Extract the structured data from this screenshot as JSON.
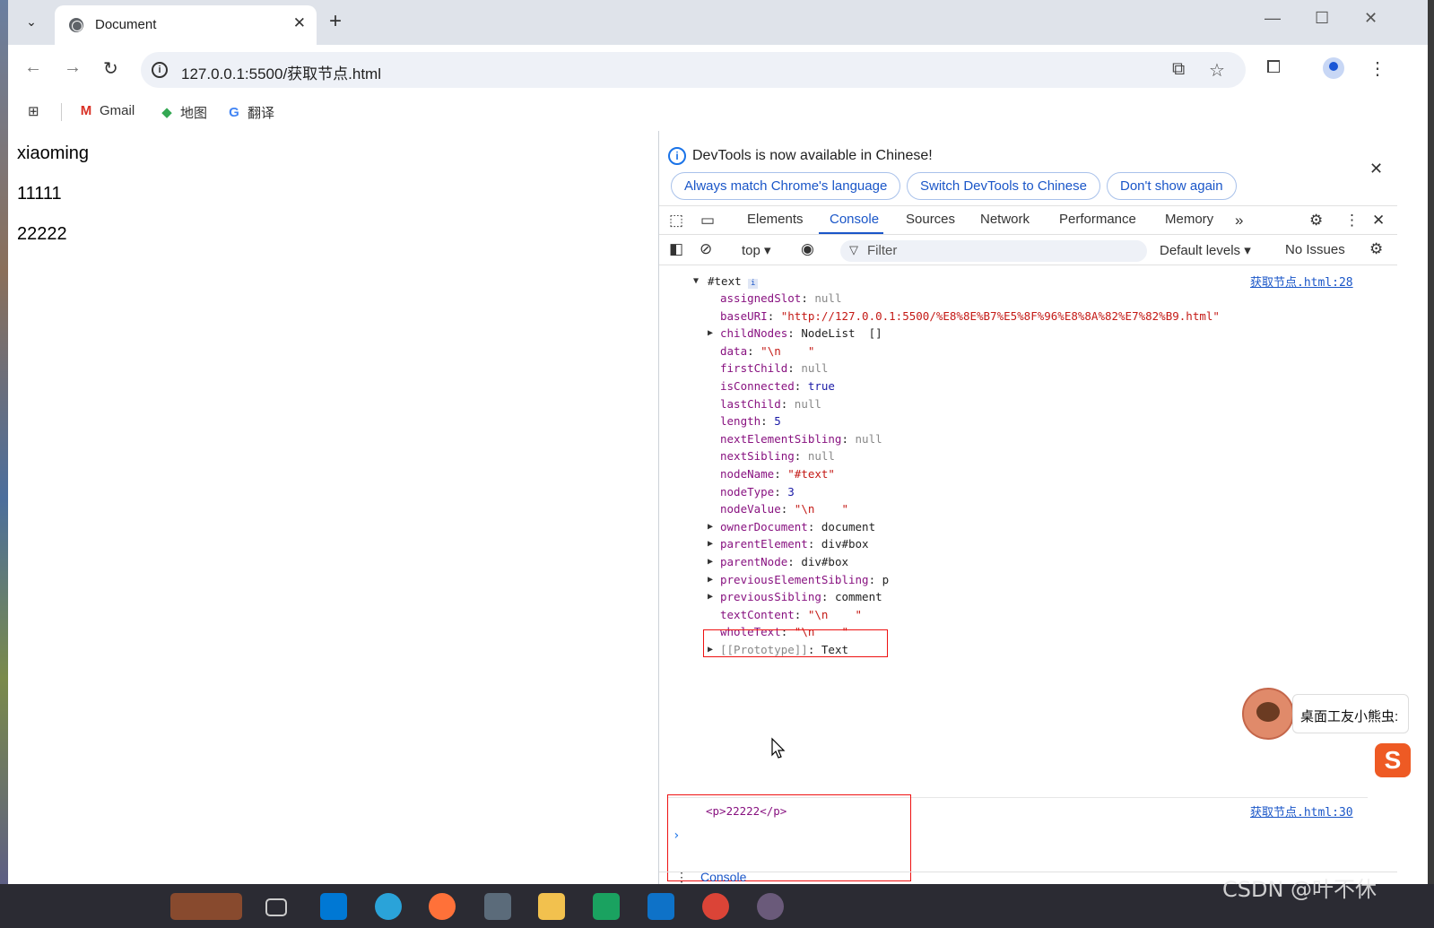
{
  "browser": {
    "tab_title": "Document",
    "url": "127.0.0.1:5500/获取节点.html",
    "bookmarks": [
      {
        "label": "Gmail",
        "icon": "gmail-icon"
      },
      {
        "label": "地图",
        "icon": "maps-icon"
      },
      {
        "label": "翻译",
        "icon": "translate-icon"
      }
    ]
  },
  "page": {
    "lines": [
      "xiaoming",
      "11111",
      "22222"
    ]
  },
  "devtools": {
    "infobar": {
      "message": "DevTools is now available in Chinese!",
      "buttons": [
        "Always match Chrome's language",
        "Switch DevTools to Chinese",
        "Don't show again"
      ]
    },
    "tabs": [
      "Elements",
      "Console",
      "Sources",
      "Network",
      "Performance",
      "Memory"
    ],
    "active_tab": "Console",
    "filterbar": {
      "context": "top",
      "filter_placeholder": "Filter",
      "levels": "Default levels",
      "issues": "No Issues"
    },
    "console": {
      "entry1": {
        "header": "#text",
        "source": "获取节点.html:28",
        "props": [
          {
            "key": "assignedSlot",
            "value": "null",
            "type": "nul",
            "expandable": false
          },
          {
            "key": "baseURI",
            "value": "\"http://127.0.0.1:5500/%E8%8E%B7%E5%8F%96%E8%8A%82%E7%82%B9.html\"",
            "type": "str",
            "expandable": false
          },
          {
            "key": "childNodes",
            "value": "NodeList  []",
            "type": "obj",
            "expandable": true
          },
          {
            "key": "data",
            "value": "\"\\n    \"",
            "type": "str",
            "expandable": false
          },
          {
            "key": "firstChild",
            "value": "null",
            "type": "nul",
            "expandable": false
          },
          {
            "key": "isConnected",
            "value": "true",
            "type": "bool",
            "expandable": false
          },
          {
            "key": "lastChild",
            "value": "null",
            "type": "nul",
            "expandable": false
          },
          {
            "key": "length",
            "value": "5",
            "type": "num",
            "expandable": false
          },
          {
            "key": "nextElementSibling",
            "value": "null",
            "type": "nul",
            "expandable": false
          },
          {
            "key": "nextSibling",
            "value": "null",
            "type": "nul",
            "expandable": false
          },
          {
            "key": "nodeName",
            "value": "\"#text\"",
            "type": "str",
            "expandable": false
          },
          {
            "key": "nodeType",
            "value": "3",
            "type": "num",
            "expandable": false
          },
          {
            "key": "nodeValue",
            "value": "\"\\n    \"",
            "type": "str",
            "expandable": false
          },
          {
            "key": "ownerDocument",
            "value": "document",
            "type": "obj",
            "expandable": true
          },
          {
            "key": "parentElement",
            "value": "div#box",
            "type": "obj",
            "expandable": true
          },
          {
            "key": "parentNode",
            "value": "div#box",
            "type": "obj",
            "expandable": true
          },
          {
            "key": "previousElementSibling",
            "value": "p",
            "type": "obj",
            "expandable": true
          },
          {
            "key": "previousSibling",
            "value": "comment",
            "type": "obj",
            "expandable": true
          },
          {
            "key": "textContent",
            "value": "\"\\n    \"",
            "type": "str",
            "expandable": false
          },
          {
            "key": "wholeText",
            "value": "\"\\n    \"",
            "type": "str",
            "expandable": false
          },
          {
            "key": "[[Prototype]]",
            "value": "Text",
            "type": "obj",
            "expandable": true
          }
        ]
      },
      "entry2": {
        "text": "<p>22222</p>",
        "source": "获取节点.html:30"
      },
      "drawer_label": "Console"
    }
  },
  "overlay": {
    "assistant_label": "桌面工友小熊虫:"
  },
  "watermark": "CSDN @叶不休"
}
